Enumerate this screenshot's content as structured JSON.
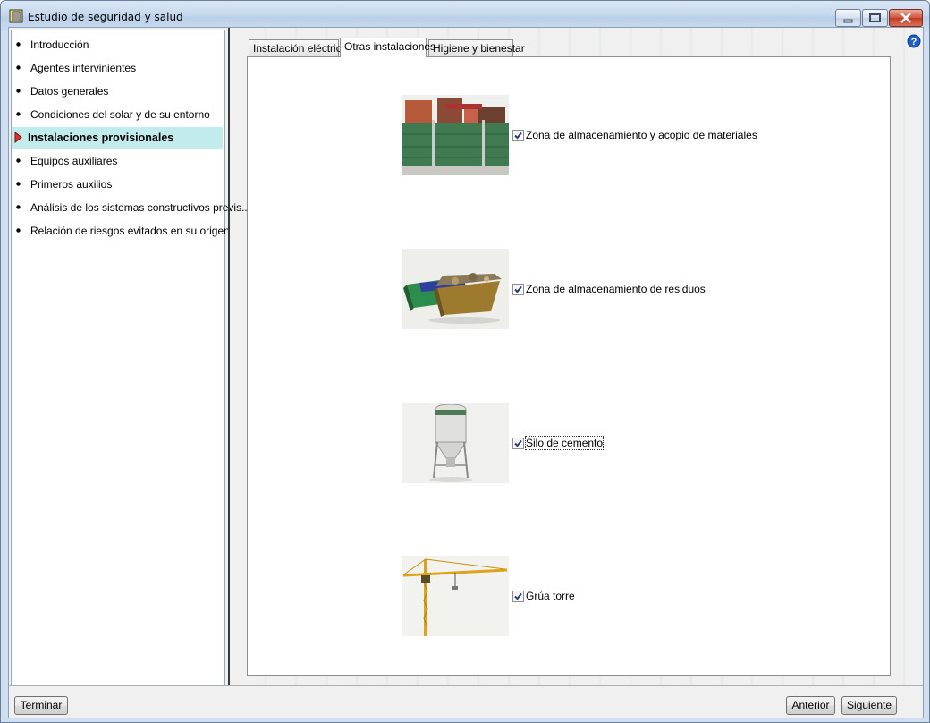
{
  "window": {
    "title": "Estudio de seguridad y salud",
    "controls": [
      "minimize-icon",
      "maximize-icon",
      "close-icon"
    ]
  },
  "sidebar": {
    "items": [
      {
        "label": "Introducción",
        "selected": false
      },
      {
        "label": "Agentes intervinientes",
        "selected": false
      },
      {
        "label": "Datos generales",
        "selected": false
      },
      {
        "label": "Condiciones del solar y de su entorno",
        "selected": false
      },
      {
        "label": "Instalaciones provisionales",
        "selected": true
      },
      {
        "label": "Equipos auxiliares",
        "selected": false
      },
      {
        "label": "Primeros auxilios",
        "selected": false
      },
      {
        "label": "Análisis de los sistemas constructivos previs...",
        "selected": false
      },
      {
        "label": "Relación de riesgos evitados en su origen",
        "selected": false
      }
    ]
  },
  "tabs": [
    {
      "label": "Instalación eléctrica",
      "active": false
    },
    {
      "label": "Otras instalaciones",
      "active": true
    },
    {
      "label": "Higiene y bienestar",
      "active": false
    }
  ],
  "items": [
    {
      "label": "Zona de almacenamiento y acopio de materiales",
      "checked": true,
      "icon": "material-storage-image"
    },
    {
      "label": "Zona de almacenamiento de residuos",
      "checked": true,
      "icon": "waste-container-image"
    },
    {
      "label": "Silo de cemento",
      "checked": true,
      "icon": "cement-silo-image"
    },
    {
      "label": "Grúa torre",
      "checked": true,
      "icon": "tower-crane-image"
    }
  ],
  "buttons": {
    "finish": "Terminar",
    "previous": "Anterior",
    "next": "Siguiente"
  },
  "colors": {
    "selected_nav": "#c2ecec",
    "title_bar": "#c4d7ed",
    "close_button": "#c23a22"
  }
}
